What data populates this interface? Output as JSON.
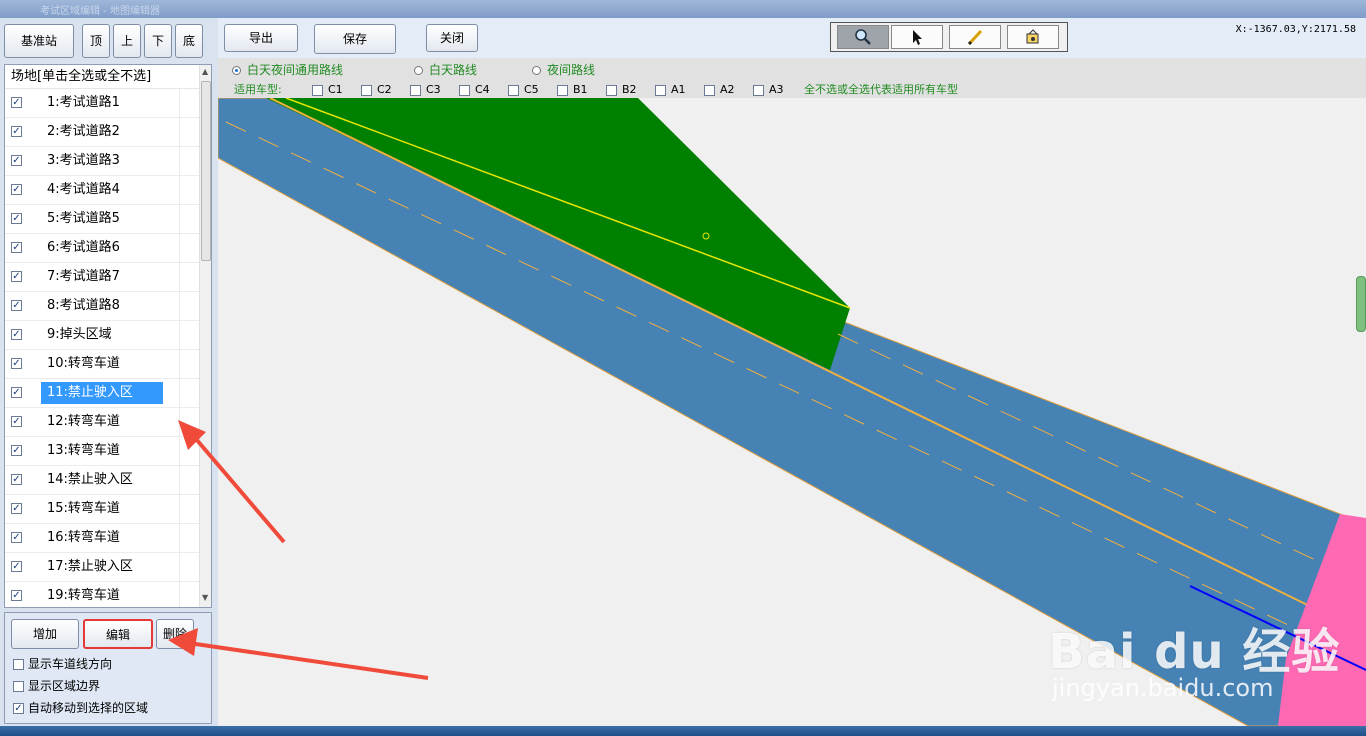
{
  "window": {
    "title": "考试区域编辑 - 地图编辑器"
  },
  "nav_buttons": [
    {
      "label": "基准站"
    },
    {
      "label": "顶"
    },
    {
      "label": "上"
    },
    {
      "label": "下"
    },
    {
      "label": "底"
    }
  ],
  "list": {
    "header": "场地[单击全选或全不选]",
    "items": [
      {
        "label": "1:考试道路1",
        "checked": true
      },
      {
        "label": "2:考试道路2",
        "checked": true
      },
      {
        "label": "3:考试道路3",
        "checked": true
      },
      {
        "label": "4:考试道路4",
        "checked": true
      },
      {
        "label": "5:考试道路5",
        "checked": true
      },
      {
        "label": "6:考试道路6",
        "checked": true
      },
      {
        "label": "7:考试道路7",
        "checked": true
      },
      {
        "label": "8:考试道路8",
        "checked": true
      },
      {
        "label": "9:掉头区域",
        "checked": true
      },
      {
        "label": "10:转弯车道",
        "checked": true
      },
      {
        "label": "11:禁止驶入区",
        "checked": true,
        "selected": true
      },
      {
        "label": "12:转弯车道",
        "checked": true
      },
      {
        "label": "13:转弯车道",
        "checked": true
      },
      {
        "label": "14:禁止驶入区",
        "checked": true
      },
      {
        "label": "15:转弯车道",
        "checked": true
      },
      {
        "label": "16:转弯车道",
        "checked": true
      },
      {
        "label": "17:禁止驶入区",
        "checked": true
      },
      {
        "label": "19:转弯车道",
        "checked": true
      }
    ]
  },
  "actions": {
    "add": "增加",
    "edit": "编辑",
    "delete": "删除"
  },
  "options": [
    {
      "label": "显示车道线方向",
      "checked": false
    },
    {
      "label": "显示区域边界",
      "checked": false
    },
    {
      "label": "自动移动到选择的区域",
      "checked": true
    }
  ],
  "toolbar": {
    "export": "导出",
    "save": "保存",
    "close": "关闭"
  },
  "tools": [
    {
      "icon": "zoom-icon",
      "active": true
    },
    {
      "icon": "pointer-icon",
      "active": false
    },
    {
      "icon": "pencil-icon",
      "active": false
    },
    {
      "icon": "paint-icon",
      "active": false
    }
  ],
  "coords": "X:-1367.03,Y:2171.58",
  "routes": [
    {
      "label": "白天夜间通用路线",
      "selected": true
    },
    {
      "label": "白天路线",
      "selected": false
    },
    {
      "label": "夜间路线",
      "selected": false
    }
  ],
  "vehicle": {
    "label": "适用车型:",
    "types": [
      "C1",
      "C2",
      "C3",
      "C4",
      "C5",
      "B1",
      "B2",
      "A1",
      "A2",
      "A3"
    ],
    "note": "全不选或全选代表适用所有车型"
  },
  "colors": {
    "road": "#4682b4",
    "grass": "#008000",
    "pink": "#ff69b4",
    "arrow": "#f04a3a",
    "highlight": "#e53935",
    "route_text": "#228b22"
  },
  "watermark": {
    "logo": "Bai du 经验",
    "url": "jingyan.baidu.com"
  }
}
